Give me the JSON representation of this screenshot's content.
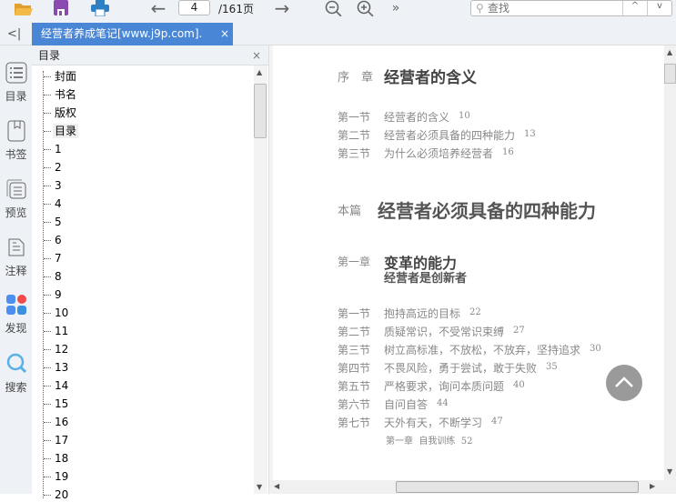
{
  "toolbar": {
    "page_current": "4",
    "page_total": "/161页",
    "more": "»",
    "search_placeholder": "查找",
    "search_prev": "^",
    "search_next": "v"
  },
  "tabs": {
    "collapse": "<|",
    "active_tab": "经营者养成笔记[www.j9p.com].",
    "close": "×",
    "add": "+"
  },
  "leftbar": [
    {
      "label": "目录"
    },
    {
      "label": "书签"
    },
    {
      "label": "预览"
    },
    {
      "label": "注释"
    },
    {
      "label": "发现"
    },
    {
      "label": "搜索"
    }
  ],
  "toc": {
    "title": "目录",
    "close": "×",
    "items": [
      "封面",
      "书名",
      "版权",
      "目录",
      "1",
      "2",
      "3",
      "4",
      "5",
      "6",
      "7",
      "8",
      "9",
      "10",
      "11",
      "12",
      "13",
      "14",
      "15",
      "16",
      "17",
      "18",
      "19",
      "20"
    ],
    "selected": "目录"
  },
  "page": {
    "prologue": {
      "label": "序　章",
      "title": "经营者的含义",
      "sections": [
        {
          "label": "第一节",
          "title": "经营者的含义",
          "page": "10"
        },
        {
          "label": "第二节",
          "title": "经营者必须具备的四种能力",
          "page": "13"
        },
        {
          "label": "第三节",
          "title": "为什么必须培养经营者",
          "page": "16"
        }
      ]
    },
    "part": {
      "label": "本篇",
      "title": "经营者必须具备的四种能力"
    },
    "chapter": {
      "label": "第一章",
      "title": "变革的能力",
      "subtitle": "经营者是创新者",
      "sections": [
        {
          "label": "第一节",
          "title": "抱持高远的目标",
          "page": "22"
        },
        {
          "label": "第二节",
          "title": "质疑常识，不受常识束缚",
          "page": "27"
        },
        {
          "label": "第三节",
          "title": "树立高标准，不放松，不放弃，坚持追求",
          "page": "30"
        },
        {
          "label": "第四节",
          "title": "不畏风险，勇于尝试，敢于失败",
          "page": "35"
        },
        {
          "label": "第五节",
          "title": "严格要求，询问本质问题",
          "page": "40"
        },
        {
          "label": "第六节",
          "title": "自问自答",
          "page": "44"
        },
        {
          "label": "第七节",
          "title": "天外有天，不断学习",
          "page": "47"
        }
      ],
      "training": {
        "label": "第一章",
        "title": "自我训练",
        "page": "52"
      }
    }
  },
  "colors": {
    "accent": "#4a86d6",
    "up_button": "#9a9a9a"
  }
}
